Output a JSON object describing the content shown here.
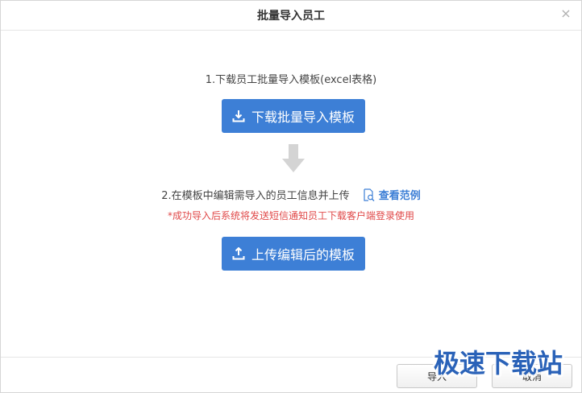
{
  "dialog": {
    "title": "批量导入员工",
    "close_glyph": "×"
  },
  "step1": {
    "text": "1.下载员工批量导入模板(excel表格)",
    "button_label": "下载批量导入模板",
    "button_icon": "download-icon"
  },
  "step2": {
    "text": "2.在模板中编辑需导入的员工信息并上传",
    "example_link": "查看范例",
    "example_icon": "magnify-document-icon",
    "notice": "*成功导入后系统将发送短信通知员工下载客户端登录使用",
    "button_label": "上传编辑后的模板",
    "button_icon": "upload-icon"
  },
  "footer": {
    "import_label": "导入",
    "cancel_label": "取消"
  },
  "watermark": {
    "text": "极速下载站"
  },
  "colors": {
    "primary": "#3d7fd6",
    "notice": "#e04848",
    "arrow": "#d4d4d4"
  }
}
